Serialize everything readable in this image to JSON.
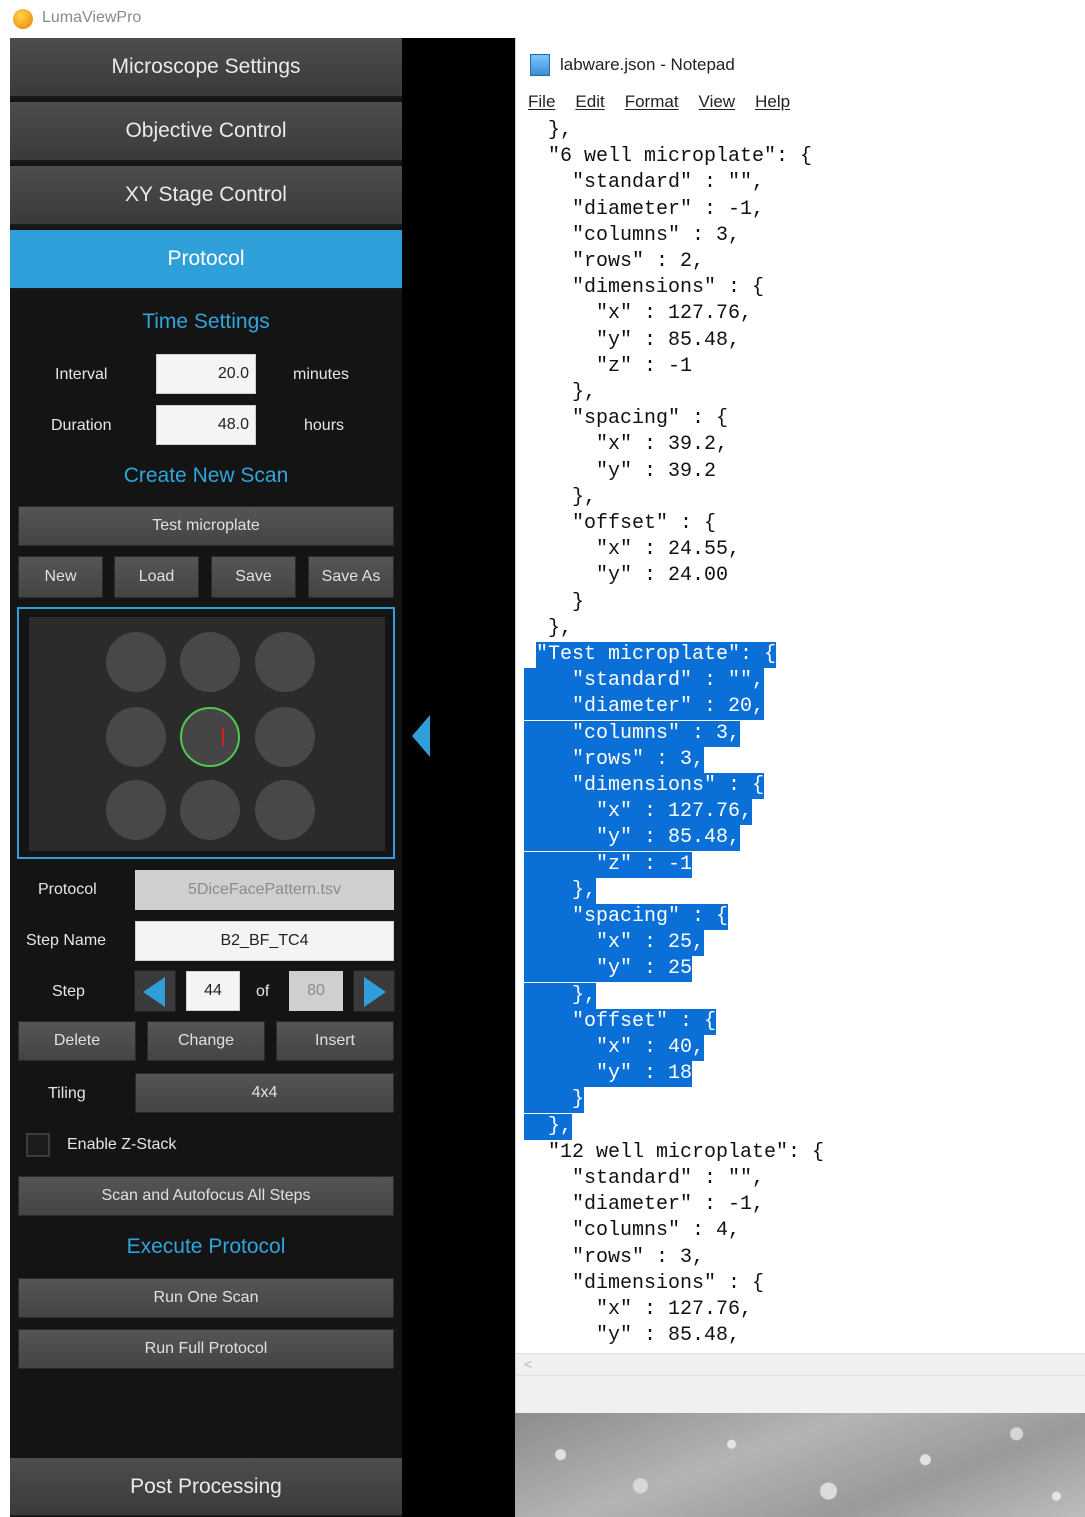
{
  "app": {
    "title": "LumaViewPro"
  },
  "sidebar": {
    "accordion": [
      {
        "label": "Microscope Settings"
      },
      {
        "label": "Objective Control"
      },
      {
        "label": "XY Stage Control"
      },
      {
        "label": "Protocol",
        "active": true
      }
    ],
    "post_processing_label": "Post Processing"
  },
  "protocol_panel": {
    "time_settings": {
      "title": "Time Settings",
      "interval": {
        "label": "Interval",
        "value": "20.0",
        "unit": "minutes"
      },
      "duration": {
        "label": "Duration",
        "value": "48.0",
        "unit": "hours"
      }
    },
    "create_new_scan": {
      "title": "Create New Scan",
      "labware_select": "Test microplate",
      "buttons": {
        "new": "New",
        "load": "Load",
        "save": "Save",
        "save_as": "Save As"
      }
    },
    "protocol_row": {
      "label": "Protocol",
      "value": "5DiceFacePattern.tsv"
    },
    "step_name_row": {
      "label": "Step Name",
      "value": "B2_BF_TC4"
    },
    "step_row": {
      "label": "Step",
      "current": "44",
      "of_label": "of",
      "total": "80"
    },
    "step_buttons": {
      "delete": "Delete",
      "change": "Change",
      "insert": "Insert"
    },
    "tiling": {
      "label": "Tiling",
      "value": "4x4"
    },
    "z_stack": {
      "label": "Enable Z-Stack",
      "checked": false
    },
    "scan_autofocus_label": "Scan and Autofocus All Steps",
    "execute": {
      "title": "Execute Protocol",
      "run_one_scan": "Run One Scan",
      "run_full_protocol": "Run Full Protocol"
    }
  },
  "notepad": {
    "title": "labware.json - Notepad",
    "menu": [
      "File",
      "Edit",
      "Format",
      "View",
      "Help"
    ],
    "lines": [
      "  },",
      "  \"6 well microplate\": {",
      "    \"standard\" : \"\",",
      "    \"diameter\" : -1,",
      "    \"columns\" : 3,",
      "    \"rows\" : 2,",
      "    \"dimensions\" : {",
      "      \"x\" : 127.76,",
      "      \"y\" : 85.48,",
      "      \"z\" : -1",
      "    },",
      "    \"spacing\" : {",
      "      \"x\" : 39.2,",
      "      \"y\" : 39.2",
      "    },",
      "    \"offset\" : {",
      "      \"x\" : 24.55,",
      "      \"y\" : 24.00",
      "    }",
      "  },",
      "  \"Test microplate\": {",
      "    \"standard\" : \"\",",
      "    \"diameter\" : 20,",
      "    \"columns\" : 3,",
      "    \"rows\" : 3,",
      "    \"dimensions\" : {",
      "      \"x\" : 127.76,",
      "      \"y\" : 85.48,",
      "      \"z\" : -1",
      "    },",
      "    \"spacing\" : {",
      "      \"x\" : 25,",
      "      \"y\" : 25",
      "    },",
      "    \"offset\" : {",
      "      \"x\" : 40,",
      "      \"y\" : 18",
      "    }",
      "  },",
      "  \"12 well microplate\": {",
      "    \"standard\" : \"\",",
      "    \"diameter\" : -1,",
      "    \"columns\" : 4,",
      "    \"rows\" : 3,",
      "    \"dimensions\" : {",
      "      \"x\" : 127.76,",
      "      \"y\" : 85.48,"
    ],
    "highlight_start": 20,
    "highlight_end": 38
  },
  "colors": {
    "accent": "#2e9fd8",
    "panel_bg": "#141414",
    "selection": "#0a6fd6"
  }
}
